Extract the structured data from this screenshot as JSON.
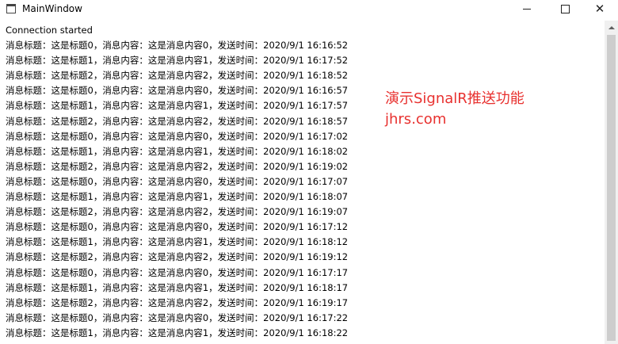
{
  "window": {
    "title": "MainWindow",
    "close_glyph": "✕"
  },
  "log": {
    "status": "Connection started",
    "lines": [
      "消息标题：这是标题0，消息内容：这是消息内容0，发送时间：2020/9/1 16:16:52",
      "消息标题：这是标题1，消息内容：这是消息内容1，发送时间：2020/9/1 16:17:52",
      "消息标题：这是标题2，消息内容：这是消息内容2，发送时间：2020/9/1 16:18:52",
      "消息标题：这是标题0，消息内容：这是消息内容0，发送时间：2020/9/1 16:16:57",
      "消息标题：这是标题1，消息内容：这是消息内容1，发送时间：2020/9/1 16:17:57",
      "消息标题：这是标题2，消息内容：这是消息内容2，发送时间：2020/9/1 16:18:57",
      "消息标题：这是标题0，消息内容：这是消息内容0，发送时间：2020/9/1 16:17:02",
      "消息标题：这是标题1，消息内容：这是消息内容1，发送时间：2020/9/1 16:18:02",
      "消息标题：这是标题2，消息内容：这是消息内容2，发送时间：2020/9/1 16:19:02",
      "消息标题：这是标题0，消息内容：这是消息内容0，发送时间：2020/9/1 16:17:07",
      "消息标题：这是标题1，消息内容：这是消息内容1，发送时间：2020/9/1 16:18:07",
      "消息标题：这是标题2，消息内容：这是消息内容2，发送时间：2020/9/1 16:19:07",
      "消息标题：这是标题0，消息内容：这是消息内容0，发送时间：2020/9/1 16:17:12",
      "消息标题：这是标题1，消息内容：这是消息内容1，发送时间：2020/9/1 16:18:12",
      "消息标题：这是标题2，消息内容：这是消息内容2，发送时间：2020/9/1 16:19:12",
      "消息标题：这是标题0，消息内容：这是消息内容0，发送时间：2020/9/1 16:17:17",
      "消息标题：这是标题1，消息内容：这是消息内容1，发送时间：2020/9/1 16:18:17",
      "消息标题：这是标题2，消息内容：这是消息内容2，发送时间：2020/9/1 16:19:17",
      "消息标题：这是标题0，消息内容：这是消息内容0，发送时间：2020/9/1 16:17:22",
      "消息标题：这是标题1，消息内容：这是消息内容1，发送时间：2020/9/1 16:18:22"
    ]
  },
  "overlay": {
    "line1": "演示SignalR推送功能",
    "line2": "jhrs.com",
    "color": "#e8312f"
  }
}
